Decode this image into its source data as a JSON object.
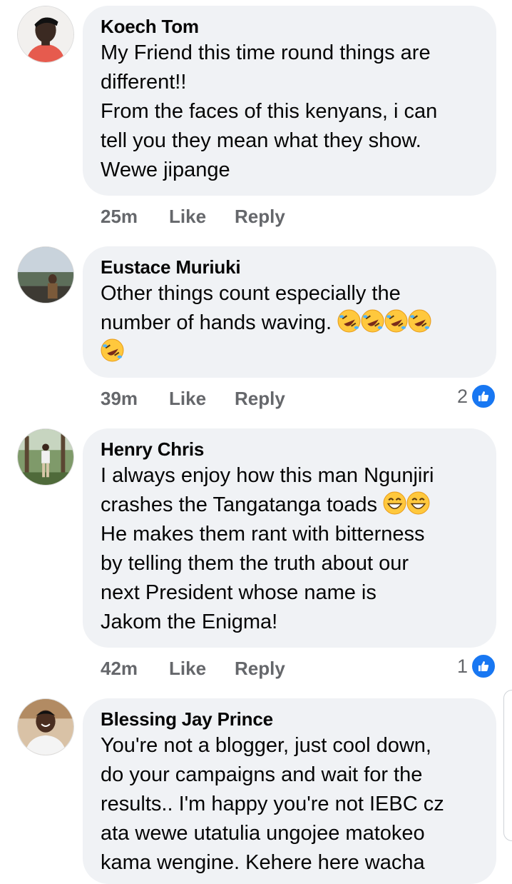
{
  "comments": [
    {
      "author": "Koech Tom",
      "lines": [
        "My Friend this time round things are",
        "different!!",
        "From the faces of this kenyans, i can",
        "tell you they mean what they show.",
        "Wewe jipange"
      ],
      "time": "25m",
      "like_label": "Like",
      "reply_label": "Reply"
    },
    {
      "author": "Eustace Muriuki",
      "lines": [
        "Other things count especially the",
        "number of hands waving."
      ],
      "time": "39m",
      "like_label": "Like",
      "reply_label": "Reply",
      "reaction_count": "2",
      "emoji": "rolling-on-floor-laughing"
    },
    {
      "author": "Henry Chris",
      "lines": [
        "I always enjoy how this man Ngunjiri",
        "crashes the Tangatanga toads",
        "He makes them rant with bitterness",
        "by telling them the truth about our",
        "next President whose name is",
        "Jakom the Enigma!"
      ],
      "time": "42m",
      "like_label": "Like",
      "reply_label": "Reply",
      "reaction_count": "1",
      "emoji": "grinning-smiling-eyes"
    },
    {
      "author": "Blessing Jay Prince",
      "lines": [
        "You're not a blogger, just cool down,",
        "do your campaigns and wait for the",
        "results.. I'm happy you're not IEBC cz",
        "ata wewe utatulia ungojee matokeo",
        "kama wengine. Kehere here wacha"
      ]
    }
  ],
  "colors": {
    "bubble": "#f0f2f5",
    "meta_text": "#65676b",
    "like_blue": "#1877f2"
  }
}
